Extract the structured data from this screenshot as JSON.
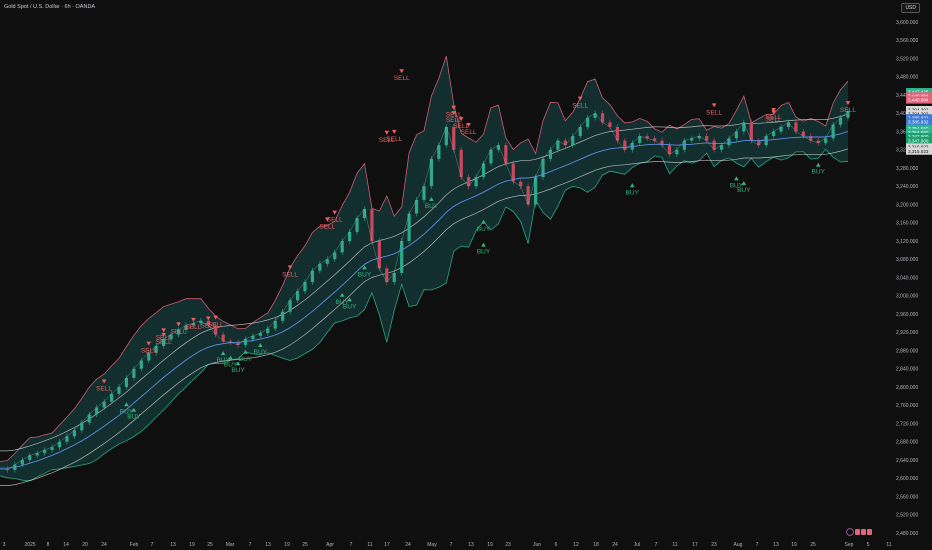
{
  "header": {
    "title": "Gold Spot / U.S. Dollar · 6h · OANDA",
    "currency": "USD"
  },
  "colors": {
    "background": "#0f0f0f",
    "sell": "#f05e5e",
    "buy": "#36b37e",
    "band_outer": "#e6e6e6",
    "mid_line": "#5b8ee0",
    "upper_band": "#e0647a",
    "lower_band": "#2fb58c",
    "fill_bull": "#1e6b6e",
    "fill_bear": "#5a2333",
    "candle_up": "#2fa88a",
    "candle_down": "#c9485b"
  },
  "chart_data": {
    "type": "line",
    "symbol": "XAUUSD",
    "y_axis_ticks": [
      "2,480.000",
      "2,520.000",
      "2,560.000",
      "2,600.000",
      "2,640.000",
      "2,680.000",
      "2,720.000",
      "2,760.000",
      "2,800.000",
      "2,840.000",
      "2,880.000",
      "2,920.000",
      "2,960.000",
      "3,000.000",
      "3,040.000",
      "3,080.000",
      "3,120.000",
      "3,160.000",
      "3,200.000",
      "3,240.000",
      "3,280.000",
      "3,320.000",
      "3,360.000",
      "3,400.000",
      "3,440.000",
      "3,480.000",
      "3,520.000",
      "3,560.000",
      "3,600.000"
    ],
    "ylim": [
      2480,
      3600
    ],
    "x_axis_ticks": [
      "3",
      "2025",
      "8",
      "14",
      "20",
      "24",
      "Feb",
      "7",
      "13",
      "19",
      "25",
      "Mar",
      "7",
      "13",
      "19",
      "25",
      "Apr",
      "7",
      "11",
      "17",
      "24",
      "May",
      "7",
      "13",
      "19",
      "23",
      "Jun",
      "6",
      "12",
      "18",
      "24",
      "Jul",
      "7",
      "11",
      "17",
      "23",
      "Aug",
      "7",
      "13",
      "19",
      "25",
      "Sep",
      "5",
      "11"
    ],
    "series": [
      {
        "values": [
          2620,
          2618,
          2630,
          2640,
          2650,
          2655,
          2662,
          2668,
          2680,
          2692,
          2705,
          2722,
          2740,
          2755,
          2768,
          2785,
          2800,
          2820,
          2840,
          2858,
          2875,
          2890,
          2905,
          2915,
          2925,
          2935,
          2940,
          2945,
          2935,
          2915,
          2900,
          2898,
          2892,
          2905,
          2912,
          2918,
          2928,
          2945,
          2965,
          2990,
          3010,
          3030,
          3055,
          3070,
          3080,
          3095,
          3120,
          3140,
          3170,
          3190,
          3120,
          3060,
          3030,
          3050,
          3120,
          3180,
          3210,
          3240,
          3300,
          3330,
          3370,
          3320,
          3260,
          3240,
          3260,
          3290,
          3320,
          3330,
          3290,
          3250,
          3240,
          3200,
          3260,
          3300,
          3320,
          3340,
          3330,
          3350,
          3370,
          3390,
          3400,
          3380,
          3370,
          3340,
          3320,
          3335,
          3350,
          3345,
          3340,
          3330,
          3310,
          3320,
          3340,
          3345,
          3350,
          3340,
          3320,
          3330,
          3345,
          3360,
          3380,
          3340,
          3330,
          3350,
          3360,
          3370,
          3380,
          3360,
          3350,
          3340,
          3335,
          3345,
          3375,
          3390,
          3405
        ]
      },
      {
        "values": [
          2622,
          2622,
          2624,
          2628,
          2633,
          2638,
          2644,
          2650,
          2657,
          2665,
          2673,
          2682,
          2692,
          2703,
          2714,
          2726,
          2738,
          2751,
          2765,
          2779,
          2793,
          2807,
          2821,
          2834,
          2847,
          2859,
          2870,
          2880,
          2887,
          2892,
          2895,
          2897,
          2898,
          2900,
          2902,
          2905,
          2909,
          2914,
          2921,
          2930,
          2941,
          2953,
          2966,
          2980,
          2994,
          3008,
          3023,
          3038,
          3054,
          3069,
          3078,
          3083,
          3087,
          3092,
          3100,
          3110,
          3122,
          3135,
          3150,
          3166,
          3183,
          3196,
          3205,
          3212,
          3219,
          3227,
          3236,
          3245,
          3251,
          3255,
          3258,
          3258,
          3261,
          3266,
          3272,
          3279,
          3285,
          3292,
          3299,
          3306,
          3313,
          3318,
          3322,
          3324,
          3325,
          3327,
          3329,
          3331,
          3332,
          3332,
          3331,
          3330,
          3331,
          3332,
          3334,
          3335,
          3334,
          3334,
          3335,
          3337,
          3340,
          3340,
          3340,
          3341,
          3342,
          3344,
          3346,
          3347,
          3348,
          3348,
          3348,
          3348,
          3351,
          3355,
          3360
        ]
      }
    ],
    "signals": [
      {
        "type": "SELL",
        "label": "SELL",
        "i": 18,
        "y": 2810
      },
      {
        "type": "BUY",
        "label": "BUY",
        "i": 21,
        "y": 2760
      },
      {
        "type": "BUY",
        "label": "BUY",
        "i": 22,
        "y": 2748
      },
      {
        "type": "SELL",
        "label": "SELL",
        "i": 25,
        "y": 2893
      },
      {
        "type": "SELL",
        "label": "SELL",
        "i": 27,
        "y": 2912
      },
      {
        "type": "SELL",
        "label": "SELL",
        "i": 28,
        "y": 2922
      },
      {
        "type": "SELL",
        "label": "SELL",
        "i": 30,
        "y": 2935
      },
      {
        "type": "SELL",
        "label": "SELL",
        "i": 33,
        "y": 2945
      },
      {
        "type": "SELL",
        "label": "SELL",
        "i": 35,
        "y": 2948
      },
      {
        "type": "SELL",
        "label": "SELL",
        "i": 36,
        "y": 2950
      },
      {
        "type": "BUY",
        "label": "BUY",
        "i": 38,
        "y": 2872
      },
      {
        "type": "BUY",
        "label": "BUY",
        "i": 39,
        "y": 2862
      },
      {
        "type": "BUY",
        "label": "BUY",
        "i": 40,
        "y": 2850
      },
      {
        "type": "BUY",
        "label": "BUY",
        "i": 42,
        "y": 2875
      },
      {
        "type": "BUY",
        "label": "BUY",
        "i": 44,
        "y": 2890
      },
      {
        "type": "SELL",
        "label": "SELL",
        "i": 49,
        "y": 3060
      },
      {
        "type": "SELL",
        "label": "SELL",
        "i": 55,
        "y": 3165
      },
      {
        "type": "SELL",
        "label": "SELL",
        "i": 57,
        "y": 3180
      },
      {
        "type": "BUY",
        "label": "BUY",
        "i": 58,
        "y": 3000
      },
      {
        "type": "BUY",
        "label": "BUY",
        "i": 59,
        "y": 2990
      },
      {
        "type": "BUY",
        "label": "BUY",
        "i": 61,
        "y": 3060
      },
      {
        "type": "SELL",
        "label": "SELL",
        "i": 65,
        "y": 3355
      },
      {
        "type": "SELL",
        "label": "SELL",
        "i": 67,
        "y": 3357
      },
      {
        "type": "SELL",
        "label": "SELL",
        "i": 68,
        "y": 3490
      },
      {
        "type": "BUY",
        "label": "BUY",
        "i": 73,
        "y": 3210
      },
      {
        "type": "SELL",
        "label": "SELL",
        "i": 76,
        "y": 3410
      },
      {
        "type": "SELL",
        "label": "SELL",
        "i": 77,
        "y": 3398
      },
      {
        "type": "SELL",
        "label": "SELL",
        "i": 78,
        "y": 3385
      },
      {
        "type": "SELL",
        "label": "SELL",
        "i": 79,
        "y": 3372
      },
      {
        "type": "BUY",
        "label": "BUY",
        "i": 81,
        "y": 3160
      },
      {
        "type": "BUY",
        "label": "BUY",
        "i": 82,
        "y": 3110
      },
      {
        "type": "SELL",
        "label": "SELL",
        "i": 98,
        "y": 3430
      },
      {
        "type": "BUY",
        "label": "BUY",
        "i": 107,
        "y": 3240
      },
      {
        "type": "SELL",
        "label": "SELL",
        "i": 121,
        "y": 3415
      },
      {
        "type": "BUY",
        "label": "BUY",
        "i": 124,
        "y": 3255
      },
      {
        "type": "BUY",
        "label": "BUY",
        "i": 126,
        "y": 3245
      },
      {
        "type": "SELL",
        "label": "SELL",
        "i": 130,
        "y": 3405
      },
      {
        "type": "SELL",
        "label": "SELL",
        "i": 131,
        "y": 3400
      },
      {
        "type": "BUY",
        "label": "BUY",
        "i": 138,
        "y": 3285
      },
      {
        "type": "SELL",
        "label": "SELL",
        "i": 143,
        "y": 3420
      }
    ],
    "price_tags": [
      {
        "label": "3,447.425",
        "color": "#2fb58c",
        "text": "#ffffff",
        "y": 3447.4
      },
      {
        "label": "3,440.084",
        "color": "#e0647a",
        "text": "#ffffff",
        "y": 3438
      },
      {
        "label": "3,440.084",
        "color": "#e0647a",
        "text": "#ffffff",
        "y": 3429
      },
      {
        "label": "3,394.302",
        "color": "#d9d9d9",
        "text": "#111111",
        "y": 3408
      },
      {
        "label": "3,394.302",
        "color": "#d9d9d9",
        "text": "#111111",
        "y": 3399
      },
      {
        "label": "3,385.932",
        "color": "#3f78d6",
        "text": "#ffffff",
        "y": 3390
      },
      {
        "label": "3,385.932",
        "color": "#3f78d6",
        "text": "#ffffff",
        "y": 3381
      },
      {
        "label": "3,354.660",
        "color": "#2fb58c",
        "text": "#ffffff",
        "y": 3367
      },
      {
        "label": "3,354.660",
        "color": "#2fb58c",
        "text": "#ffffff",
        "y": 3358
      },
      {
        "label": "3,347.900",
        "color": "#1f9e6e",
        "text": "#ffffff",
        "y": 3349
      },
      {
        "label": "3,347.900",
        "color": "#1f9e6e",
        "text": "#ffffff",
        "y": 3340
      },
      {
        "label": "3,315.023",
        "color": "#d9d9d9",
        "text": "#111111",
        "y": 3326
      },
      {
        "label": "3,315.023",
        "color": "#d9d9d9",
        "text": "#111111",
        "y": 3317
      }
    ],
    "legend": "none",
    "grid": false
  }
}
